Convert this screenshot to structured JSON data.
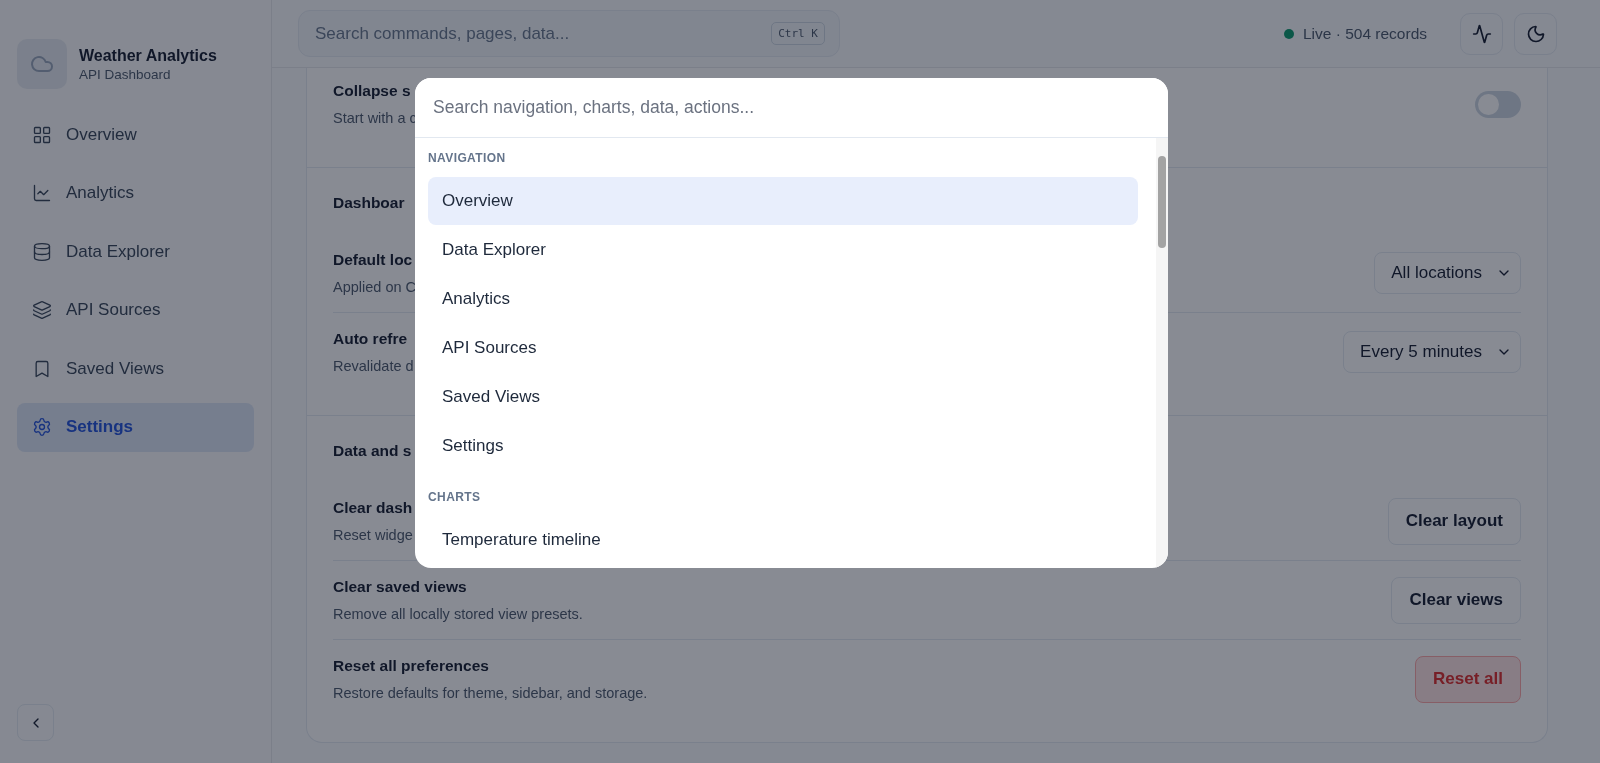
{
  "sidebar": {
    "brand": {
      "title": "Weather Analytics",
      "subtitle": "API Dashboard"
    },
    "items": [
      {
        "label": "Overview",
        "selected": false
      },
      {
        "label": "Analytics",
        "selected": false
      },
      {
        "label": "Data Explorer",
        "selected": false
      },
      {
        "label": "API Sources",
        "selected": false
      },
      {
        "label": "Saved Views",
        "selected": false
      },
      {
        "label": "Settings",
        "selected": true
      }
    ]
  },
  "header": {
    "search": {
      "placeholder": "Search commands, pages, data...",
      "shortcut": "Ctrl K"
    },
    "status": {
      "live": true,
      "text": "Live · 504 records"
    }
  },
  "settings": {
    "sections": [
      {
        "rows": [
          {
            "kind": "toggle",
            "title": "Collapse s",
            "description": "Start with a c",
            "on": false
          }
        ]
      },
      {
        "title": "Dashboar",
        "rows": [
          {
            "kind": "select",
            "title": "Default loc",
            "description": "Applied on C",
            "value": "All locations"
          },
          {
            "kind": "select",
            "title": "Auto refre",
            "description": "Revalidate d",
            "value": "Every 5 minutes"
          }
        ]
      },
      {
        "title": "Data and s",
        "rows": [
          {
            "kind": "button",
            "title": "Clear dash",
            "description": "Reset widge",
            "button": "Clear layout",
            "danger": false
          },
          {
            "kind": "button",
            "title": "Clear saved views",
            "description": "Remove all locally stored view presets.",
            "button": "Clear views",
            "danger": false
          },
          {
            "kind": "button",
            "title": "Reset all preferences",
            "description": "Restore defaults for theme, sidebar, and storage.",
            "button": "Reset all",
            "danger": true
          }
        ]
      }
    ]
  },
  "command_palette": {
    "placeholder": "Search navigation, charts, data, actions...",
    "groups": [
      {
        "title": "NAVIGATION",
        "items": [
          {
            "label": "Overview",
            "selected": true
          },
          {
            "label": "Data Explorer",
            "selected": false
          },
          {
            "label": "Analytics",
            "selected": false
          },
          {
            "label": "API Sources",
            "selected": false
          },
          {
            "label": "Saved Views",
            "selected": false
          },
          {
            "label": "Settings",
            "selected": false
          }
        ]
      },
      {
        "title": "CHARTS",
        "items": [
          {
            "label": "Temperature timeline",
            "selected": false
          }
        ]
      }
    ]
  }
}
